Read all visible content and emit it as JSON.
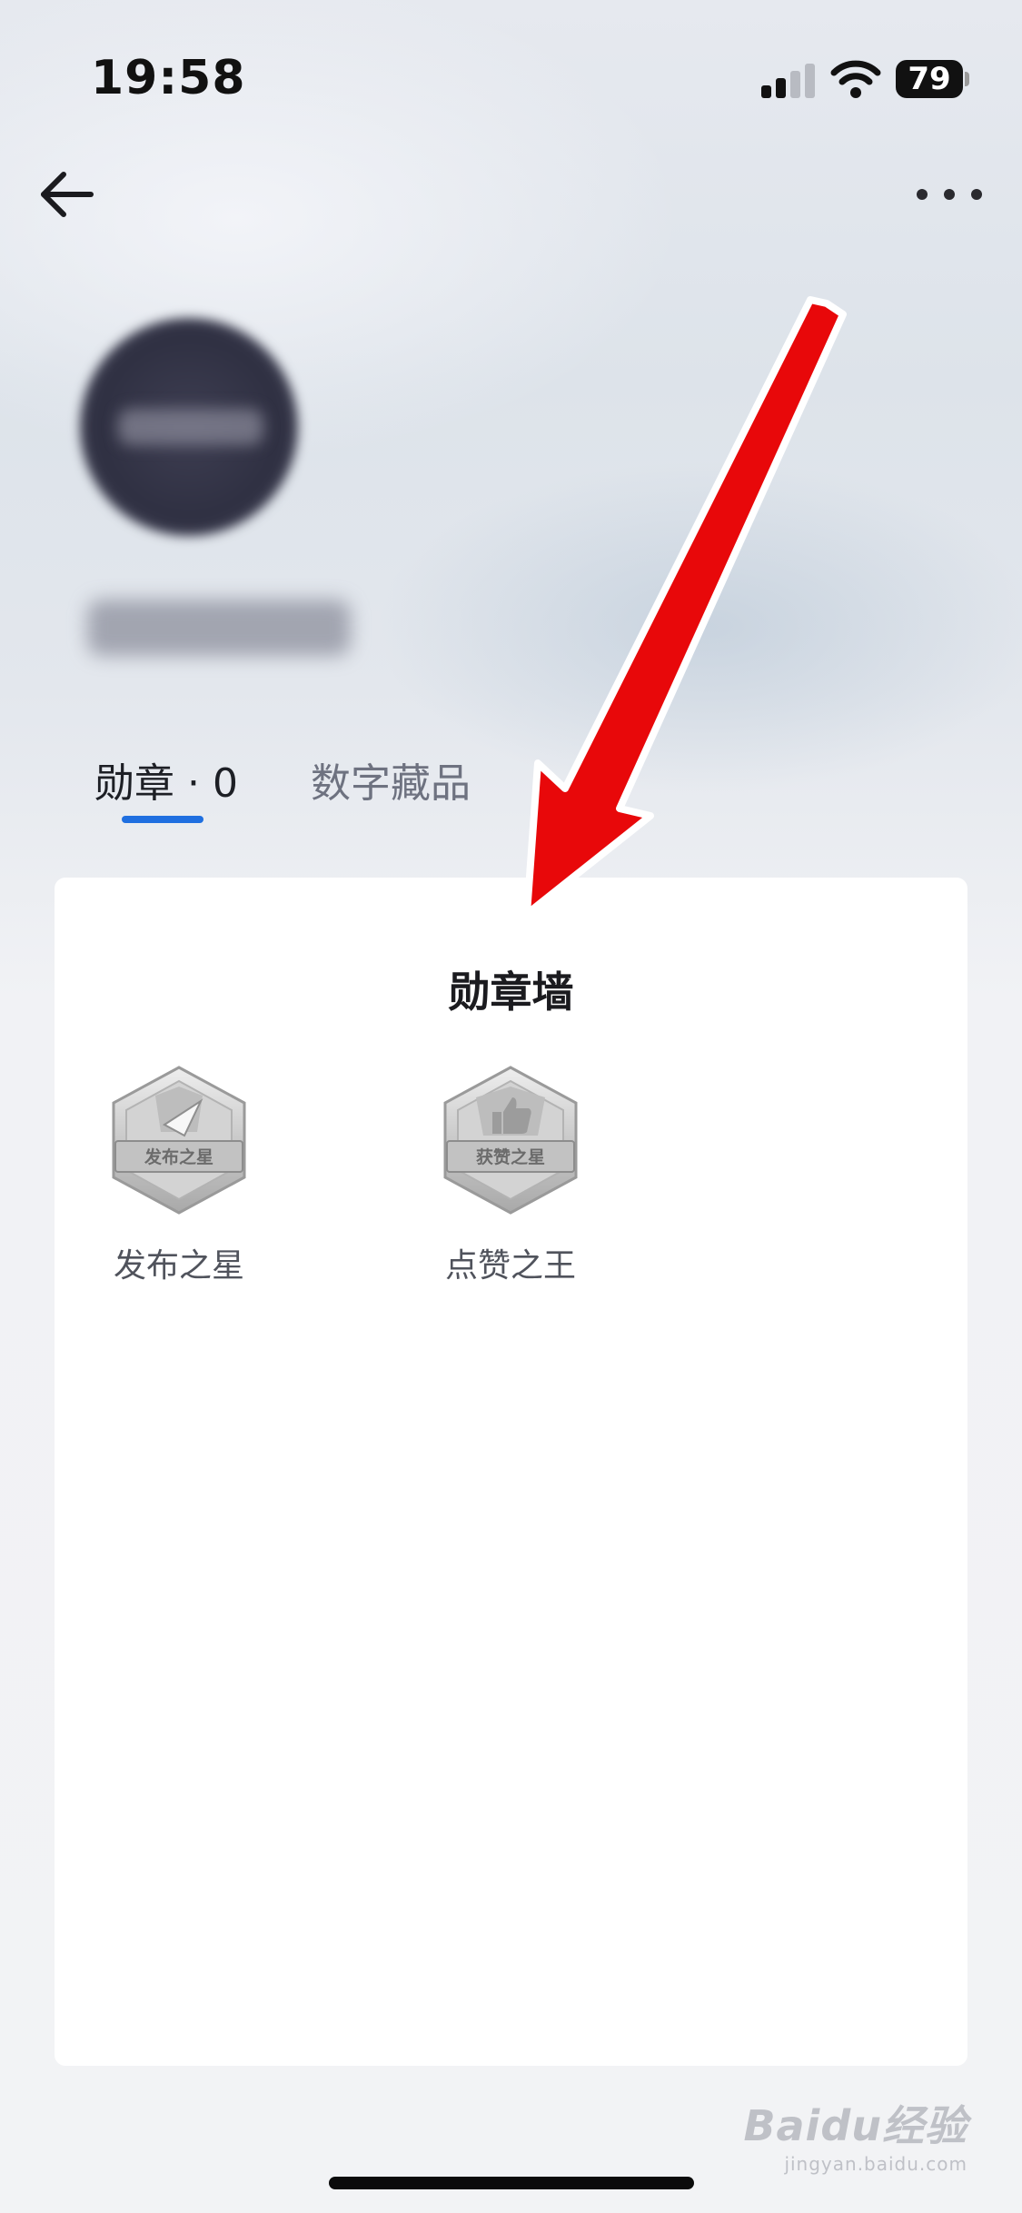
{
  "status_bar": {
    "time": "19:58",
    "battery": "79"
  },
  "header": {
    "back_icon": "arrow-left-icon",
    "more_icon": "more-dots-icon",
    "avatar_text": "",
    "username": ""
  },
  "tabs": [
    {
      "label": "勋章 · 0",
      "active": true
    },
    {
      "label": "数字藏品",
      "active": false
    }
  ],
  "badge_wall": {
    "title": "勋章墙",
    "badges": [
      {
        "label": "发布之星",
        "emblem_text": "发布之星",
        "icon": "paper-plane-icon"
      },
      {
        "label": "点赞之王",
        "emblem_text": "获赞之星",
        "icon": "thumbs-up-icon"
      }
    ]
  },
  "watermark": {
    "main": "Baidu经验",
    "sub": "jingyan.baidu.com"
  },
  "colors": {
    "accent": "#1f6fe0",
    "arrow": "#e8080a"
  }
}
